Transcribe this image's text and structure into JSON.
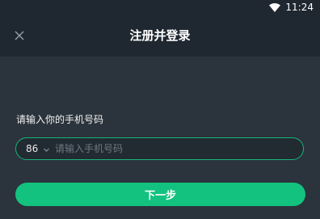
{
  "status_bar": {
    "time": "11:24",
    "wifi_icon": "wifi-icon"
  },
  "header": {
    "title": "注册并登录",
    "close_icon": "close-icon"
  },
  "form": {
    "phone_label": "请输入你的手机号码",
    "country_code": "86",
    "chevron_icon": "chevron-down-icon",
    "phone_value": "",
    "phone_placeholder": "请输入手机号码",
    "next_button_label": "下一步"
  },
  "colors": {
    "background": "#2b343c",
    "header_background": "#1f2730",
    "accent": "#13c27e",
    "input_border": "#17b57a"
  }
}
